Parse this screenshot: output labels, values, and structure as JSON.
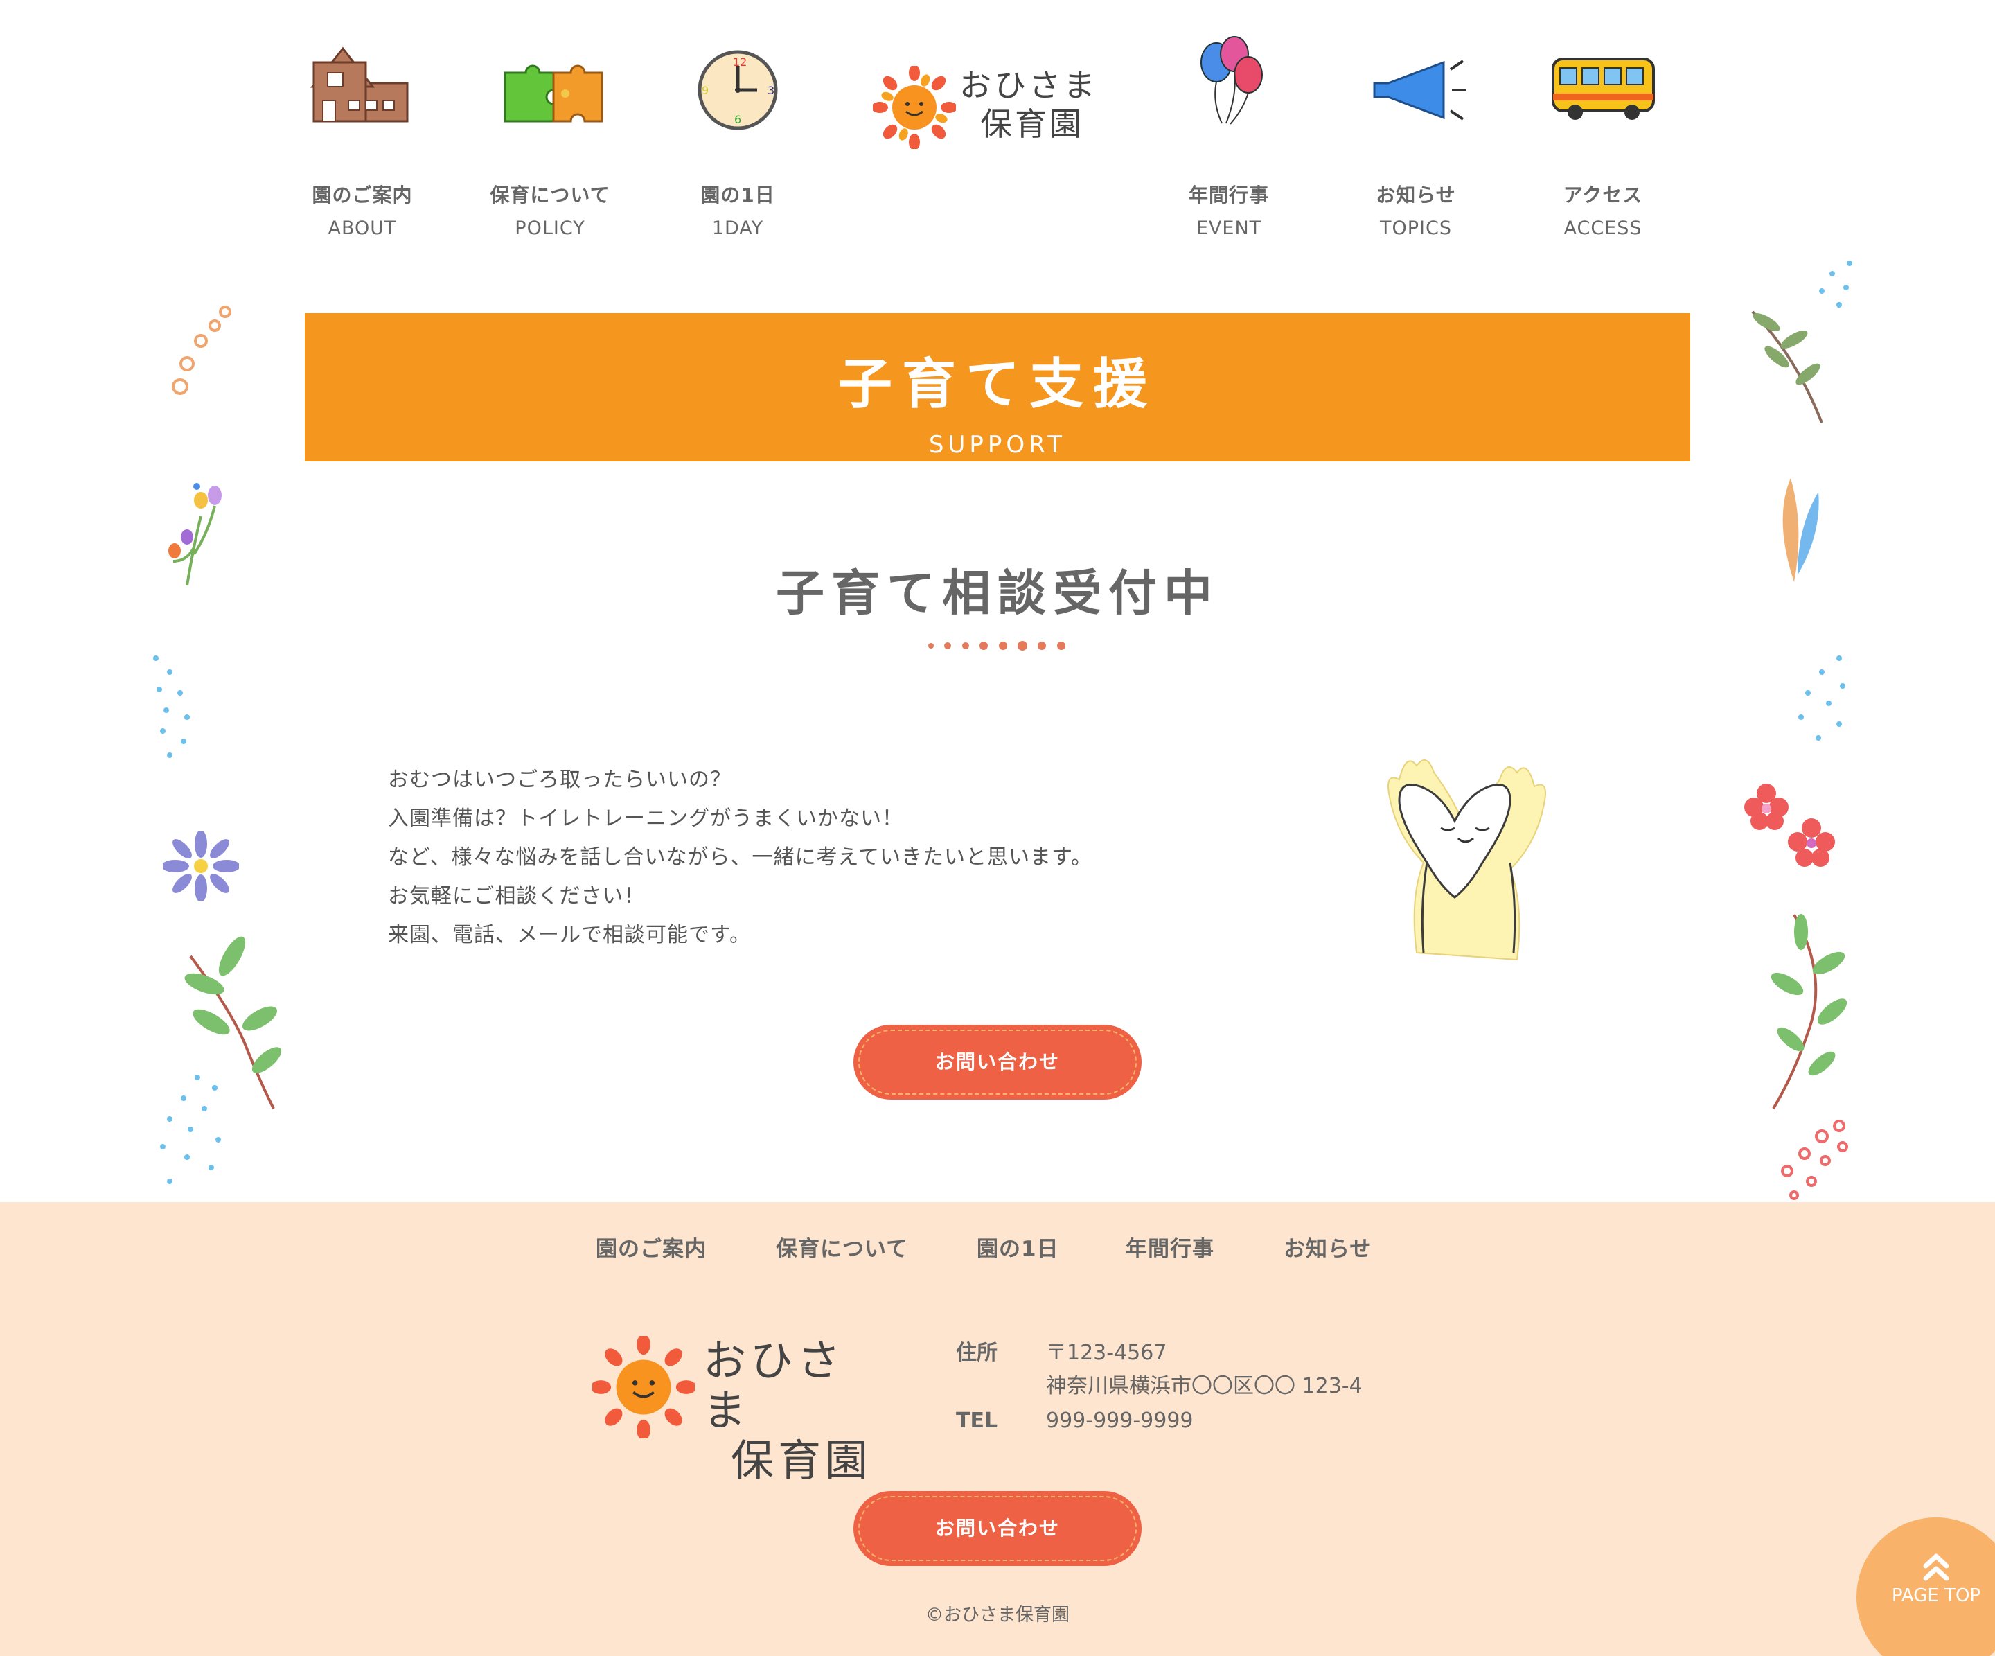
{
  "header": {
    "nav_left": [
      {
        "jp": "園のご案内",
        "en": "ABOUT",
        "icon": "school-building-icon"
      },
      {
        "jp": "保育について",
        "en": "POLICY",
        "icon": "puzzle-icon"
      },
      {
        "jp": "園の1日",
        "en": "1DAY",
        "icon": "clock-icon"
      }
    ],
    "logo": {
      "line1": "おひさま",
      "line2": "保育園",
      "icon": "sun-icon"
    },
    "nav_right": [
      {
        "jp": "年間行事",
        "en": "EVENT",
        "icon": "balloons-icon"
      },
      {
        "jp": "お知らせ",
        "en": "TOPICS",
        "icon": "megaphone-icon"
      },
      {
        "jp": "アクセス",
        "en": "ACCESS",
        "icon": "bus-icon"
      }
    ]
  },
  "banner": {
    "title": "子育て支援",
    "subtitle": "SUPPORT",
    "color": "#f5961f"
  },
  "section": {
    "title": "子育て相談受付中",
    "lines": [
      "おむつはいつごろ取ったらいいの？",
      "入園準備は？トイレトレーニングがうまくいかない！",
      "など、様々な悩みを話し合いながら、一緒に考えていきたいと思います。",
      "お気軽にご相談ください！",
      "来園、電話、メールで相談可能です。"
    ],
    "cta_label": "お問い合わせ",
    "illustration_icon": "heart-hands-icon"
  },
  "footer": {
    "nav": [
      "園のご案内",
      "保育について",
      "園の1日",
      "年間行事",
      "お知らせ"
    ],
    "logo": {
      "line1": "おひさま",
      "line2": "保育園"
    },
    "address_label": "住所",
    "postal": "〒123-4567",
    "address": "神奈川県横浜市〇〇区〇〇 123-4",
    "tel_label": "TEL",
    "tel": "999-999-9999",
    "cta_label": "お問い合わせ",
    "copyright": "©おひさま保育園",
    "background": "#fee5cf"
  },
  "pagetop": {
    "label": "PAGE TOP",
    "icon": "double-chevron-up-icon"
  },
  "colors": {
    "accent": "#f5961f",
    "button": "#ee6145",
    "pagetop": "#f9b269"
  }
}
